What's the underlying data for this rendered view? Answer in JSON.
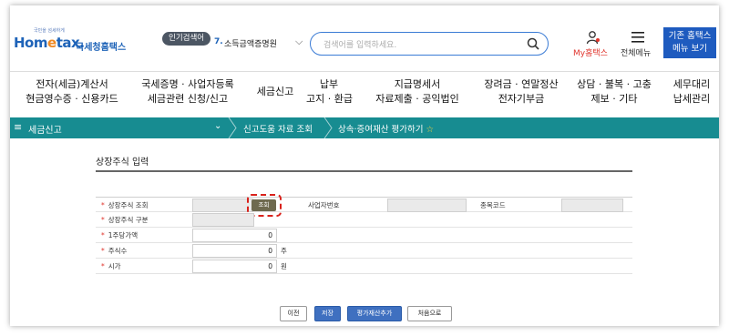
{
  "header": {
    "logo_small": "국민을 섬세하게",
    "logo_prefix": "Hom",
    "logo_e": "e",
    "logo_suffix": "tax.",
    "logo_sub": "국세청홈택스",
    "popular_badge": "인기검색어",
    "popular_rank": "7.",
    "popular_term": "소득금액증명원",
    "search_placeholder": "검색어를 입력하세요.",
    "my_home": "My홈택스",
    "all_menu": "전체메뉴",
    "classic_line1": "기존 홈택스",
    "classic_line2": "메뉴 보기"
  },
  "nav": {
    "items": [
      {
        "line1": "전자(세금)계산서",
        "line2": "현금영수증 · 신용카드"
      },
      {
        "line1": "국세증명 · 사업자등록",
        "line2": "세금관련 신청/신고"
      },
      {
        "line1": "세금신고",
        "line2": ""
      },
      {
        "line1": "납부",
        "line2": "고지 · 환급"
      },
      {
        "line1": "지급명세서",
        "line2": "자료제출 · 공익법인"
      },
      {
        "line1": "장려금 · 연말정산",
        "line2": "전자기부금"
      },
      {
        "line1": "상담 · 불복 · 고충",
        "line2": "제보 · 기타"
      },
      {
        "line1": "세무대리",
        "line2": "납세관리"
      }
    ]
  },
  "tealbar": {
    "menu_glyph": "≡",
    "section": "세금신고",
    "crumb1": "신고도움 자료 조회",
    "crumb2": "상속·증여재산 평가하기",
    "star": "☆"
  },
  "page": {
    "title": "상장주식 입력"
  },
  "form": {
    "required_mark": "*",
    "row1_label": "상장주식 조회",
    "lookup_button": "조회",
    "biz_no_label": "사업자번호",
    "stock_code_label": "종목코드",
    "row2_label": "상장주식 구분",
    "row3_label": "1주당가액",
    "row3_value": "0",
    "row4_label": "주식수",
    "row4_value": "0",
    "row4_unit": "주",
    "row5_label": "시가",
    "row5_value": "0",
    "row5_unit": "원"
  },
  "buttons": {
    "prev": "이전",
    "save": "저장",
    "add_asset": "평가재산추가",
    "first": "처음으로"
  },
  "colors": {
    "brand_blue": "#1e63b8",
    "teal": "#178c91",
    "required_red": "#e0342c",
    "highlight_red": "#d9221c"
  }
}
